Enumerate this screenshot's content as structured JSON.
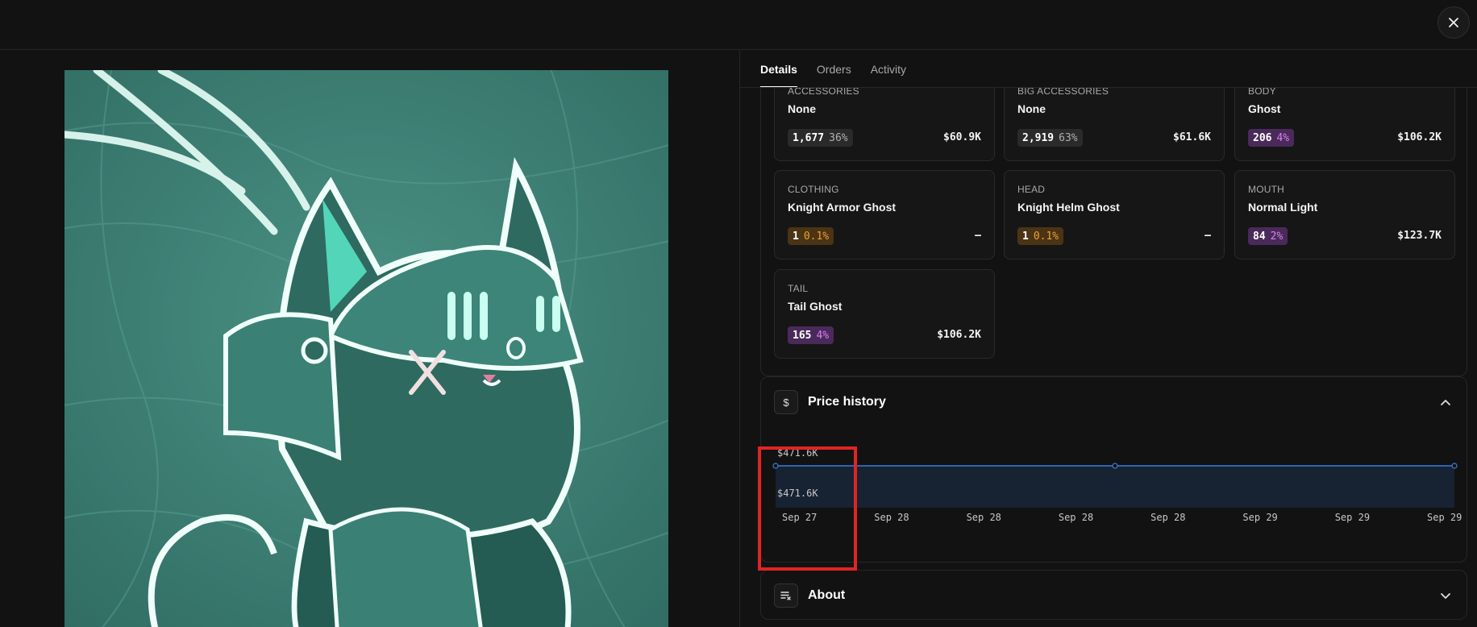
{
  "header": {
    "close_icon": "close-icon"
  },
  "tabs": [
    {
      "label": "Details",
      "active": true
    },
    {
      "label": "Orders",
      "active": false
    },
    {
      "label": "Activity",
      "active": false
    }
  ],
  "traits": [
    {
      "category": "ACCESSORIES",
      "value": "None",
      "count": "1,677",
      "percent": "36%",
      "badge": "gray",
      "price": "$60.9K"
    },
    {
      "category": "BIG ACCESSORIES",
      "value": "None",
      "count": "2,919",
      "percent": "63%",
      "badge": "gray",
      "price": "$61.6K"
    },
    {
      "category": "BODY",
      "value": "Ghost",
      "count": "206",
      "percent": "4%",
      "badge": "purple",
      "price": "$106.2K"
    },
    {
      "category": "CLOTHING",
      "value": "Knight Armor Ghost",
      "count": "1",
      "percent": "0.1%",
      "badge": "orange",
      "price": "–"
    },
    {
      "category": "HEAD",
      "value": "Knight Helm Ghost",
      "count": "1",
      "percent": "0.1%",
      "badge": "orange",
      "price": "–"
    },
    {
      "category": "MOUTH",
      "value": "Normal Light",
      "count": "84",
      "percent": "2%",
      "badge": "purple",
      "price": "$123.7K"
    },
    {
      "category": "TAIL",
      "value": "Tail Ghost",
      "count": "165",
      "percent": "4%",
      "badge": "purple",
      "price": "$106.2K"
    }
  ],
  "price_history": {
    "title": "Price history",
    "icon_symbol": "$",
    "icon": "dollar-icon",
    "expanded": true
  },
  "about": {
    "title": "About",
    "icon": "notes-icon",
    "expanded": false
  },
  "chart_data": {
    "type": "area",
    "y_tick_labels": [
      "$471.6K",
      "$471.6K"
    ],
    "x_tick_labels": [
      "Sep 27",
      "Sep 28",
      "Sep 28",
      "Sep 28",
      "Sep 28",
      "Sep 29",
      "Sep 29",
      "Sep 29"
    ],
    "series": [
      {
        "values": [
          471.6,
          471.6,
          471.6
        ]
      }
    ],
    "point_x_positions": [
      0,
      0.5,
      1
    ],
    "line_color": "#3b7ddd",
    "fill_color": "#172233",
    "grid": false
  },
  "colors": {
    "background": "#121212",
    "highlight": "#e02424"
  }
}
